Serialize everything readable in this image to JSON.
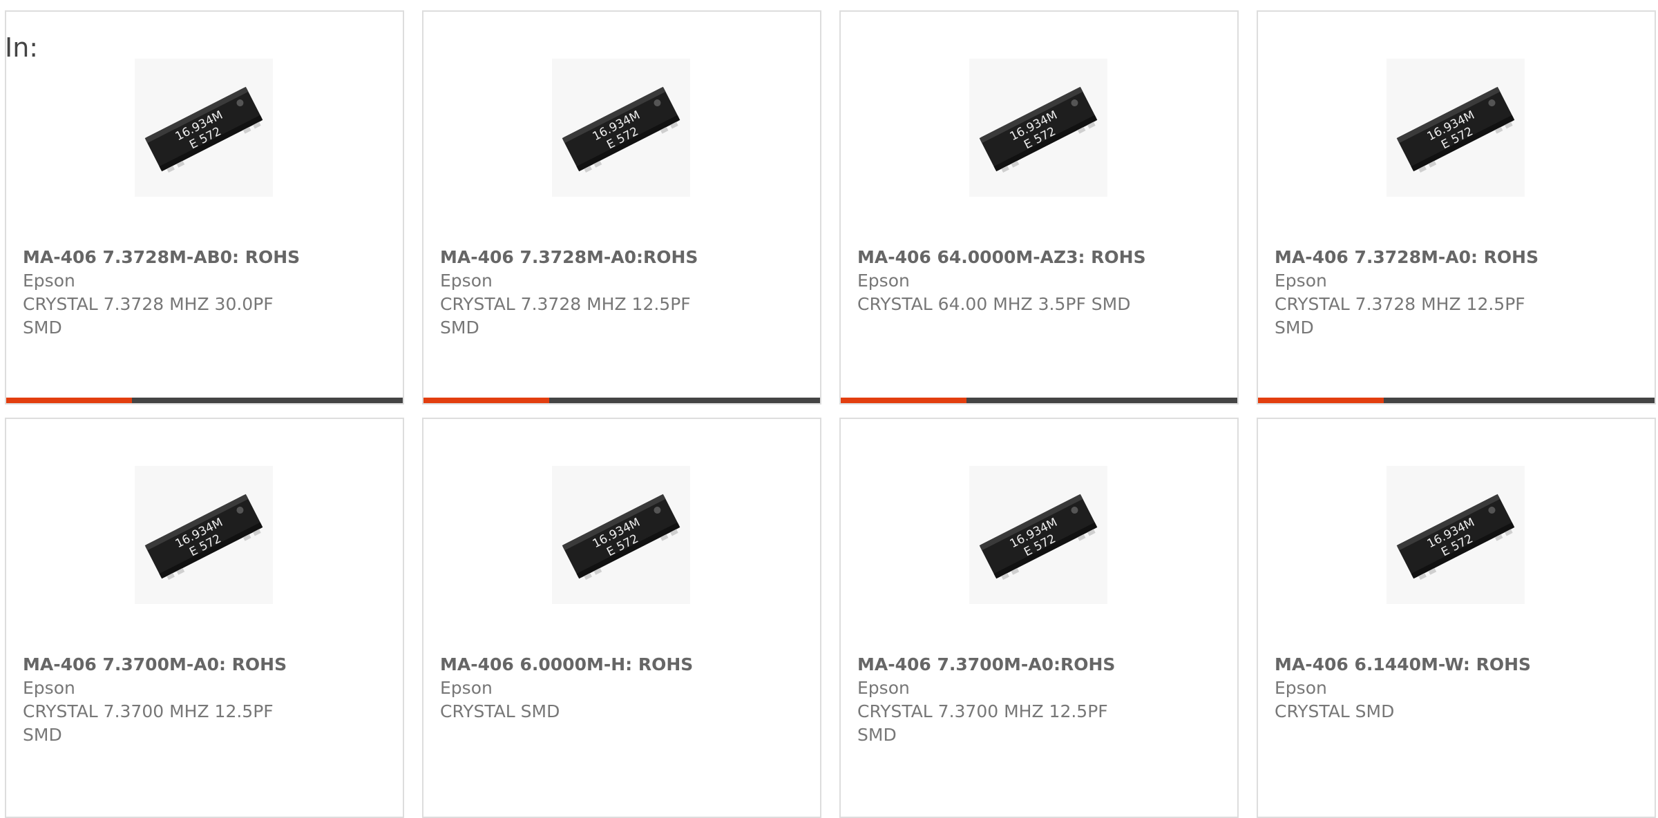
{
  "filter": {
    "label": "In:"
  },
  "colors": {
    "accent": "#e23e0f",
    "bar": "#444444",
    "border": "#dddddd"
  },
  "products": [
    {
      "part_number": "MA-406 7.3728M-AB0: ROHS",
      "manufacturer": "Epson",
      "description": "CRYSTAL 7.3728 MHZ 30.0PF SMD",
      "chip_text": [
        "16.934M",
        "E  572"
      ],
      "image": "crystal-image"
    },
    {
      "part_number": "MA-406 7.3728M-A0:ROHS",
      "manufacturer": "Epson",
      "description": "CRYSTAL 7.3728 MHZ 12.5PF SMD",
      "chip_text": [
        "16.934M",
        "E  572"
      ],
      "image": "crystal-image"
    },
    {
      "part_number": "MA-406 64.0000M-AZ3: ROHS",
      "manufacturer": "Epson",
      "description": "CRYSTAL 64.00 MHZ 3.5PF SMD",
      "chip_text": [
        "16.934M",
        "E  572"
      ],
      "image": "crystal-image"
    },
    {
      "part_number": "MA-406 7.3728M-A0: ROHS",
      "manufacturer": "Epson",
      "description": "CRYSTAL 7.3728 MHZ 12.5PF SMD",
      "chip_text": [
        "16.934M",
        "E  572"
      ],
      "image": "crystal-image"
    },
    {
      "part_number": "MA-406 7.3700M-A0: ROHS",
      "manufacturer": "Epson",
      "description": "CRYSTAL 7.3700 MHZ 12.5PF SMD",
      "chip_text": [
        "16.934M",
        "E  572"
      ],
      "image": "crystal-image"
    },
    {
      "part_number": "MA-406 6.0000M-H: ROHS",
      "manufacturer": "Epson",
      "description": "CRYSTAL SMD",
      "chip_text": [
        "16.934M",
        "E  572"
      ],
      "image": "crystal-image"
    },
    {
      "part_number": "MA-406 7.3700M-A0:ROHS",
      "manufacturer": "Epson",
      "description": "CRYSTAL 7.3700 MHZ 12.5PF SMD",
      "chip_text": [
        "16.934M",
        "E  572"
      ],
      "image": "crystal-image"
    },
    {
      "part_number": "MA-406 6.1440M-W: ROHS",
      "manufacturer": "Epson",
      "description": "CRYSTAL SMD",
      "chip_text": [
        "16.934M",
        "E  572"
      ],
      "image": "crystal-image"
    }
  ]
}
